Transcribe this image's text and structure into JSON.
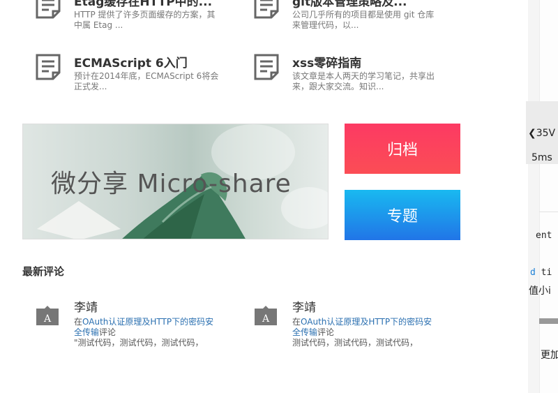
{
  "articles": [
    {
      "title": "Etag缓存在HTTP中的...",
      "desc": "HTTP 提供了许多页面缓存的方案，其中属 Etag ...",
      "icon": "document-icon"
    },
    {
      "title": "git版本管理策略及...",
      "desc": "公司几乎所有的项目都是使用 git 仓库来管理代码，以...",
      "icon": "document-icon"
    },
    {
      "title": "ECMAScript 6入门",
      "desc": "预计在2014年底，ECMAScript 6将会正式发...",
      "icon": "document-icon"
    },
    {
      "title": "xss零碎指南",
      "desc": "该文章是本人两天的学习笔记，共享出来，跟大家交流。知识...",
      "icon": "document-icon"
    }
  ],
  "banner": {
    "text": "微分享 Micro-share"
  },
  "buttons": {
    "archive": "归档",
    "topic": "专题"
  },
  "latest_comments": {
    "title": "最新评论",
    "items": [
      {
        "author": "李靖",
        "prefix": "在",
        "link": "OAuth认证原理及HTTP下的密码安全传输",
        "suffix": "评论",
        "quote": "\"测试代码，测试代码，测试代码，"
      },
      {
        "author": "李靖",
        "prefix": "在",
        "link": "OAuth认证原理及HTTP下的密码安全传输",
        "suffix": "评论",
        "quote": "测试代码，测试代码，测试代码，"
      }
    ]
  },
  "side": {
    "arrow_text": "35V",
    "ms_text": "5ms",
    "code1": "ent",
    "code2_keyword": "d",
    "code2_rest": " ti",
    "text3": "值小i",
    "text4": "更加"
  },
  "colors": {
    "archive": "#fb3f5c",
    "topic": "#1e8ceb",
    "link": "#2a6fb0"
  }
}
